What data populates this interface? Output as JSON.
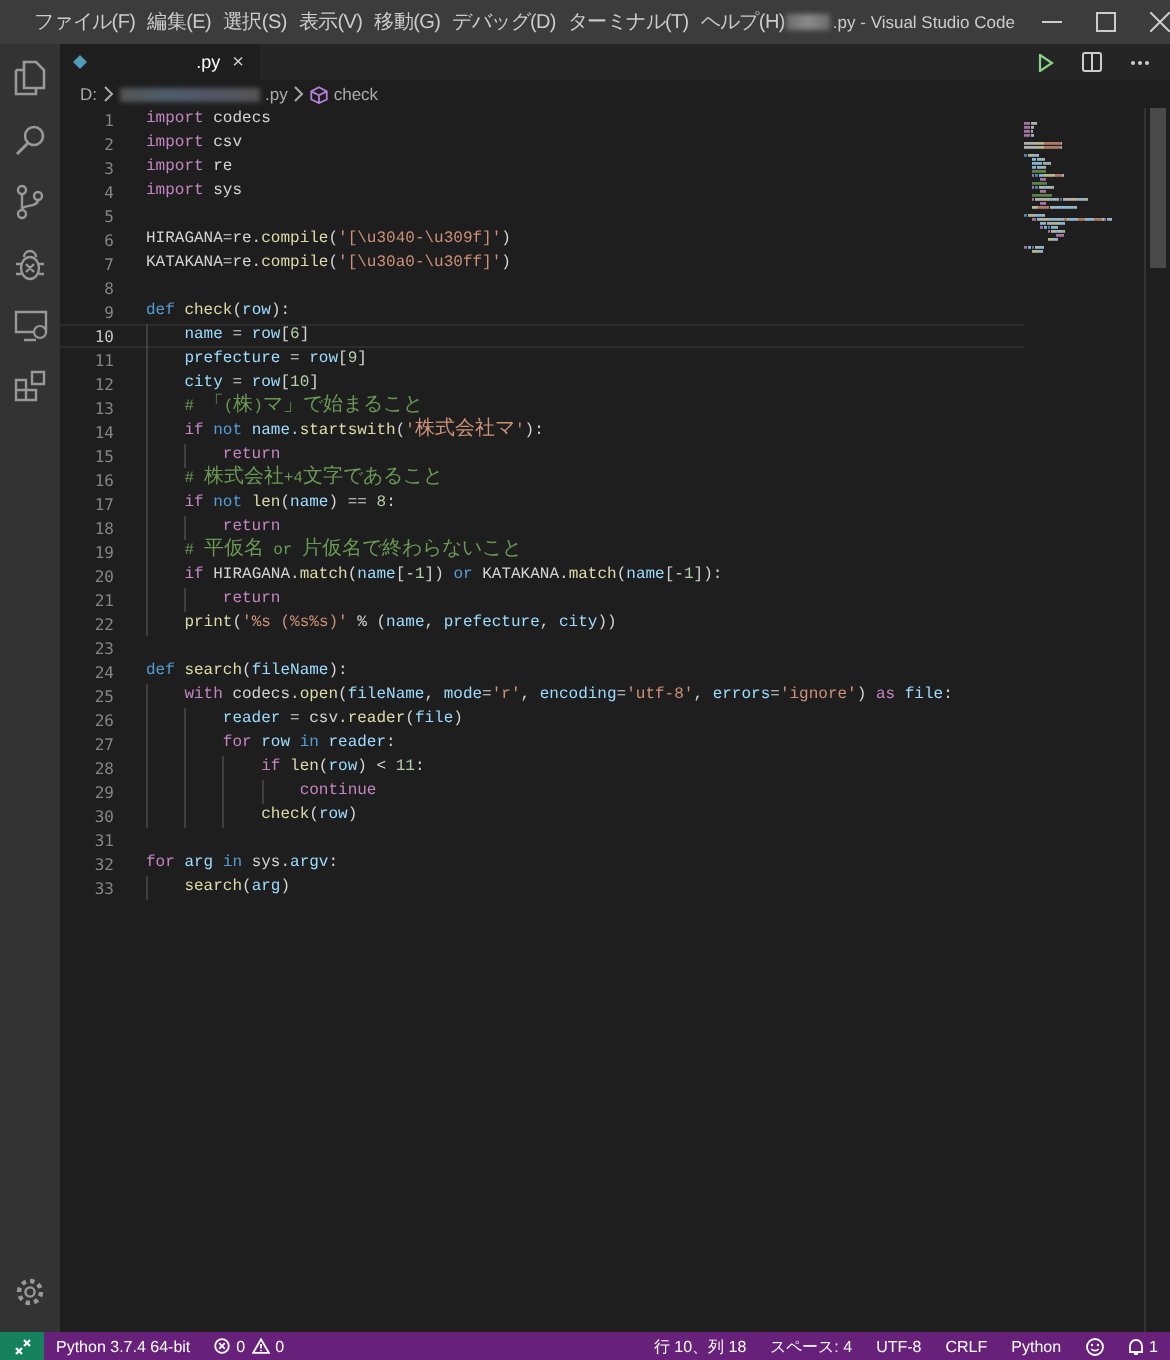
{
  "window": {
    "title": ".py - Visual Studio Code",
    "menu": [
      "ファイル(F)",
      "編集(E)",
      "選択(S)",
      "表示(V)",
      "移動(G)",
      "デバッグ(D)",
      "ターミナル(T)",
      "ヘルプ(H)"
    ]
  },
  "tabs": [
    {
      "label": ".py",
      "close": "×",
      "selected": true
    }
  ],
  "breadcrumbs": [
    {
      "label": "D:",
      "kind": "folder"
    },
    {
      "label": ".py",
      "kind": "file"
    },
    {
      "label": "check",
      "kind": "symbol"
    }
  ],
  "code": {
    "lines": [
      {
        "number": "1",
        "current": false,
        "tokens": [
          {
            "text": "import",
            "kind": "control"
          },
          {
            "text": " codecs",
            "kind": "plain"
          }
        ]
      },
      {
        "number": "2",
        "current": false,
        "tokens": [
          {
            "text": "import",
            "kind": "control"
          },
          {
            "text": " csv",
            "kind": "plain"
          }
        ]
      },
      {
        "number": "3",
        "current": false,
        "tokens": [
          {
            "text": "import",
            "kind": "control"
          },
          {
            "text": " re",
            "kind": "plain"
          }
        ]
      },
      {
        "number": "4",
        "current": false,
        "tokens": [
          {
            "text": "import",
            "kind": "control"
          },
          {
            "text": " sys",
            "kind": "plain"
          }
        ]
      },
      {
        "number": "5",
        "current": false
      },
      {
        "number": "6",
        "current": false,
        "tokens": [
          {
            "text": "HIRAGANA=re.",
            "kind": "plain"
          },
          {
            "text": "compile",
            "kind": "function"
          },
          {
            "text": "(",
            "kind": "plain"
          },
          {
            "text": "'[\\u3040-\\u309f]'",
            "kind": "string"
          },
          {
            "text": ")",
            "kind": "plain"
          }
        ]
      },
      {
        "number": "7",
        "current": false,
        "tokens": [
          {
            "text": "KATAKANA=re.",
            "kind": "plain"
          },
          {
            "text": "compile",
            "kind": "function"
          },
          {
            "text": "(",
            "kind": "plain"
          },
          {
            "text": "'[\\u30a0-\\u30ff]'",
            "kind": "string"
          },
          {
            "text": ")",
            "kind": "plain"
          }
        ]
      },
      {
        "number": "8",
        "current": false
      },
      {
        "number": "9",
        "current": false,
        "tokens": [
          {
            "text": "def",
            "kind": "keyword"
          },
          {
            "text": " check",
            "kind": "function"
          },
          {
            "text": "(",
            "kind": "plain"
          },
          {
            "text": "row",
            "kind": "variable"
          },
          {
            "text": "):",
            "kind": "plain"
          }
        ]
      },
      {
        "number": "10",
        "current": true,
        "tokens": [
          {
            "text": "    name",
            "kind": "variable"
          },
          {
            "text": " = ",
            "kind": "plain"
          },
          {
            "text": "row",
            "kind": "variable"
          },
          {
            "text": "[",
            "kind": "plain"
          },
          {
            "text": "6",
            "kind": "number"
          },
          {
            "text": "]",
            "kind": "plain"
          }
        ]
      },
      {
        "number": "11",
        "current": false,
        "tokens": [
          {
            "text": "    prefecture",
            "kind": "variable"
          },
          {
            "text": " = ",
            "kind": "plain"
          },
          {
            "text": "row",
            "kind": "variable"
          },
          {
            "text": "[",
            "kind": "plain"
          },
          {
            "text": "9",
            "kind": "number"
          },
          {
            "text": "]",
            "kind": "plain"
          }
        ]
      },
      {
        "number": "12",
        "current": false,
        "tokens": [
          {
            "text": "    city",
            "kind": "variable"
          },
          {
            "text": " = ",
            "kind": "plain"
          },
          {
            "text": "row",
            "kind": "variable"
          },
          {
            "text": "[",
            "kind": "plain"
          },
          {
            "text": "10",
            "kind": "number"
          },
          {
            "text": "]",
            "kind": "plain"
          }
        ]
      },
      {
        "number": "13",
        "current": false,
        "tokens": [
          {
            "text": "    # 「(株)マ」で始まること",
            "kind": "comment"
          }
        ]
      },
      {
        "number": "14",
        "current": false,
        "tokens": [
          {
            "text": "    if",
            "kind": "control"
          },
          {
            "text": " not",
            "kind": "keyword"
          },
          {
            "text": " name.",
            "kind": "variable"
          },
          {
            "text": "startswith",
            "kind": "function"
          },
          {
            "text": "(",
            "kind": "plain"
          },
          {
            "text": "'株式会社マ'",
            "kind": "string"
          },
          {
            "text": "):",
            "kind": "plain"
          }
        ]
      },
      {
        "number": "15",
        "current": false,
        "tokens": [
          {
            "text": "        return",
            "kind": "control"
          }
        ]
      },
      {
        "number": "16",
        "current": false,
        "tokens": [
          {
            "text": "    # 株式会社+4文字であること",
            "kind": "comment"
          }
        ]
      },
      {
        "number": "17",
        "current": false,
        "tokens": [
          {
            "text": "    if",
            "kind": "control"
          },
          {
            "text": " not",
            "kind": "keyword"
          },
          {
            "text": " len",
            "kind": "function"
          },
          {
            "text": "(",
            "kind": "plain"
          },
          {
            "text": "name",
            "kind": "variable"
          },
          {
            "text": ") == ",
            "kind": "plain"
          },
          {
            "text": "8",
            "kind": "number"
          },
          {
            "text": ":",
            "kind": "plain"
          }
        ]
      },
      {
        "number": "18",
        "current": false,
        "tokens": [
          {
            "text": "        return",
            "kind": "control"
          }
        ]
      },
      {
        "number": "19",
        "current": false,
        "tokens": [
          {
            "text": "    # 平仮名 or 片仮名で終わらないこと",
            "kind": "comment"
          }
        ]
      },
      {
        "number": "20",
        "current": false,
        "tokens": [
          {
            "text": "    if",
            "kind": "control"
          },
          {
            "text": " HIRAGANA.",
            "kind": "plain"
          },
          {
            "text": "match",
            "kind": "function"
          },
          {
            "text": "(",
            "kind": "plain"
          },
          {
            "text": "name",
            "kind": "variable"
          },
          {
            "text": "[-",
            "kind": "plain"
          },
          {
            "text": "1",
            "kind": "number"
          },
          {
            "text": "])",
            "kind": "plain"
          },
          {
            "text": " or",
            "kind": "keyword"
          },
          {
            "text": " KATAKANA.",
            "kind": "plain"
          },
          {
            "text": "match",
            "kind": "function"
          },
          {
            "text": "(",
            "kind": "plain"
          },
          {
            "text": "name",
            "kind": "variable"
          },
          {
            "text": "[-",
            "kind": "plain"
          },
          {
            "text": "1",
            "kind": "number"
          },
          {
            "text": "]):",
            "kind": "plain"
          }
        ]
      },
      {
        "number": "21",
        "current": false,
        "tokens": [
          {
            "text": "        return",
            "kind": "control"
          }
        ]
      },
      {
        "number": "22",
        "current": false,
        "tokens": [
          {
            "text": "    print",
            "kind": "function"
          },
          {
            "text": "(",
            "kind": "plain"
          },
          {
            "text": "'%s (%s%s)'",
            "kind": "string"
          },
          {
            "text": " % (",
            "kind": "plain"
          },
          {
            "text": "name",
            "kind": "variable"
          },
          {
            "text": ", ",
            "kind": "plain"
          },
          {
            "text": "prefecture",
            "kind": "variable"
          },
          {
            "text": ", ",
            "kind": "plain"
          },
          {
            "text": "city",
            "kind": "variable"
          },
          {
            "text": "))",
            "kind": "plain"
          }
        ]
      },
      {
        "number": "23",
        "current": false
      },
      {
        "number": "24",
        "current": false,
        "tokens": [
          {
            "text": "def",
            "kind": "keyword"
          },
          {
            "text": " search",
            "kind": "function"
          },
          {
            "text": "(",
            "kind": "plain"
          },
          {
            "text": "fileName",
            "kind": "variable"
          },
          {
            "text": "):",
            "kind": "plain"
          }
        ]
      },
      {
        "number": "25",
        "current": false,
        "tokens": [
          {
            "text": "    with",
            "kind": "control"
          },
          {
            "text": " codecs.",
            "kind": "plain"
          },
          {
            "text": "open",
            "kind": "function"
          },
          {
            "text": "(",
            "kind": "plain"
          },
          {
            "text": "fileName",
            "kind": "variable"
          },
          {
            "text": ", ",
            "kind": "plain"
          },
          {
            "text": "mode",
            "kind": "variable"
          },
          {
            "text": "=",
            "kind": "plain"
          },
          {
            "text": "'r'",
            "kind": "string"
          },
          {
            "text": ", ",
            "kind": "plain"
          },
          {
            "text": "encoding",
            "kind": "variable"
          },
          {
            "text": "=",
            "kind": "plain"
          },
          {
            "text": "'utf-8'",
            "kind": "string"
          },
          {
            "text": ", ",
            "kind": "plain"
          },
          {
            "text": "errors",
            "kind": "variable"
          },
          {
            "text": "=",
            "kind": "plain"
          },
          {
            "text": "'ignore'",
            "kind": "string"
          },
          {
            "text": ") ",
            "kind": "plain"
          },
          {
            "text": "as",
            "kind": "control"
          },
          {
            "text": " file",
            "kind": "variable"
          },
          {
            "text": ":",
            "kind": "plain"
          }
        ]
      },
      {
        "number": "26",
        "current": false,
        "tokens": [
          {
            "text": "        reader",
            "kind": "variable"
          },
          {
            "text": " = csv.",
            "kind": "plain"
          },
          {
            "text": "reader",
            "kind": "function"
          },
          {
            "text": "(",
            "kind": "plain"
          },
          {
            "text": "file",
            "kind": "variable"
          },
          {
            "text": ")",
            "kind": "plain"
          }
        ]
      },
      {
        "number": "27",
        "current": false,
        "tokens": [
          {
            "text": "        for",
            "kind": "control"
          },
          {
            "text": " row",
            "kind": "variable"
          },
          {
            "text": " in",
            "kind": "keyword"
          },
          {
            "text": " reader",
            "kind": "variable"
          },
          {
            "text": ":",
            "kind": "plain"
          }
        ]
      },
      {
        "number": "28",
        "current": false,
        "tokens": [
          {
            "text": "            if",
            "kind": "control"
          },
          {
            "text": " len",
            "kind": "function"
          },
          {
            "text": "(",
            "kind": "plain"
          },
          {
            "text": "row",
            "kind": "variable"
          },
          {
            "text": ") < ",
            "kind": "plain"
          },
          {
            "text": "11",
            "kind": "number"
          },
          {
            "text": ":",
            "kind": "plain"
          }
        ]
      },
      {
        "number": "29",
        "current": false,
        "tokens": [
          {
            "text": "                continue",
            "kind": "control"
          }
        ]
      },
      {
        "number": "30",
        "current": false,
        "tokens": [
          {
            "text": "            check",
            "kind": "function"
          },
          {
            "text": "(",
            "kind": "plain"
          },
          {
            "text": "row",
            "kind": "variable"
          },
          {
            "text": ")",
            "kind": "plain"
          }
        ]
      },
      {
        "number": "31",
        "current": false
      },
      {
        "number": "32",
        "current": false,
        "tokens": [
          {
            "text": "for",
            "kind": "control"
          },
          {
            "text": " arg",
            "kind": "variable"
          },
          {
            "text": " in",
            "kind": "keyword"
          },
          {
            "text": " sys.",
            "kind": "plain"
          },
          {
            "text": "argv",
            "kind": "variable"
          },
          {
            "text": ":",
            "kind": "plain"
          }
        ]
      },
      {
        "number": "33",
        "current": false,
        "tokens": [
          {
            "text": "    search",
            "kind": "function"
          },
          {
            "text": "(",
            "kind": "plain"
          },
          {
            "text": "arg",
            "kind": "variable"
          },
          {
            "text": ")",
            "kind": "plain"
          }
        ]
      }
    ]
  },
  "status_bar": {
    "interpreter": "Python 3.7.4 64-bit",
    "errors": "0",
    "warnings": "0",
    "right": [
      {
        "label": "行 10、列 18",
        "kind": "text"
      },
      {
        "label": "スペース: 4",
        "kind": "text"
      },
      {
        "label": "UTF-8",
        "kind": "text"
      },
      {
        "label": "CRLF",
        "kind": "text"
      },
      {
        "label": "Python",
        "kind": "text"
      },
      {
        "kind": "feedback"
      },
      {
        "label": "1",
        "kind": "bell"
      }
    ]
  }
}
